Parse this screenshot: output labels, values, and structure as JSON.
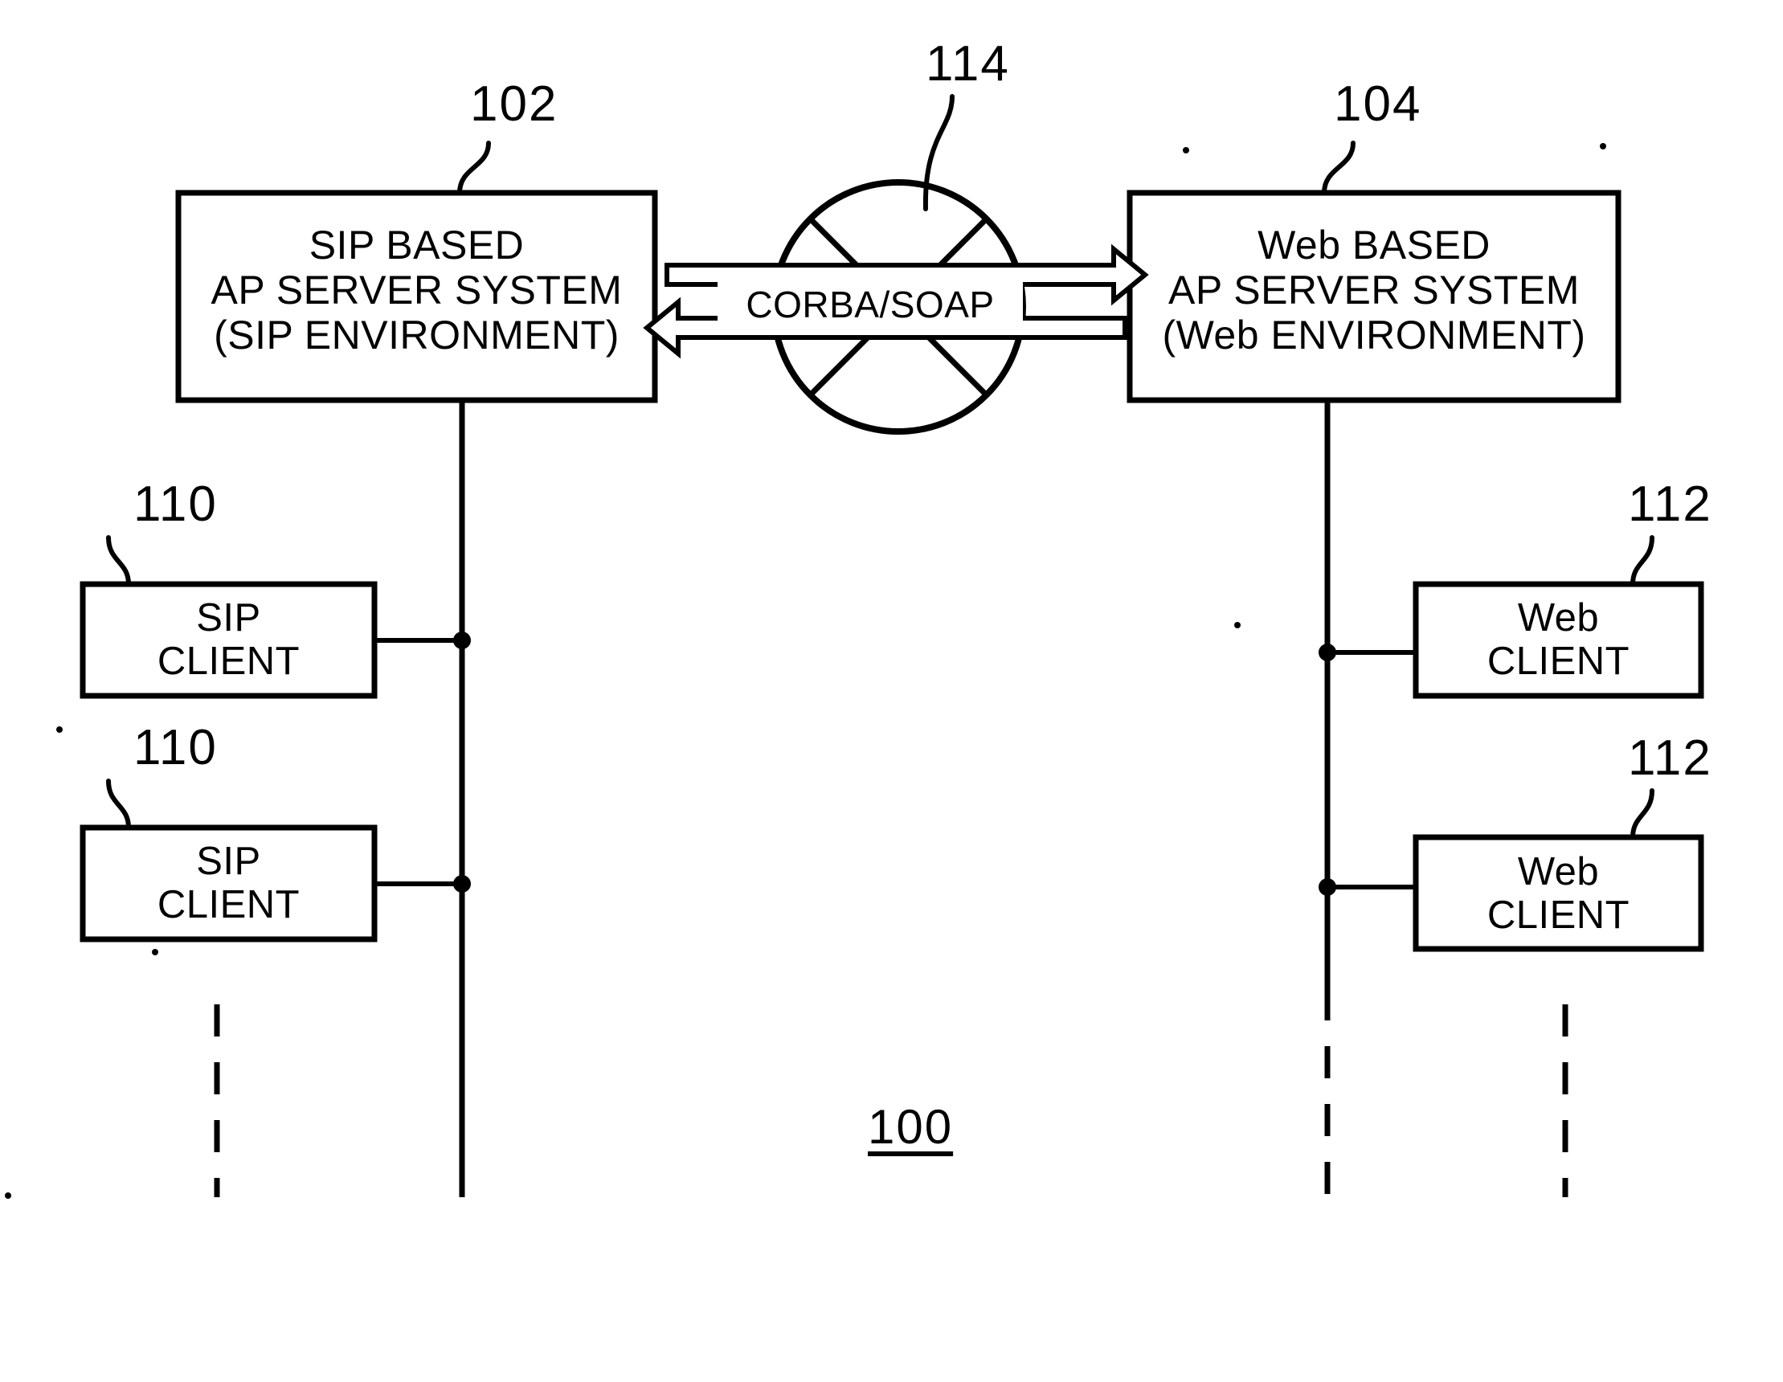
{
  "figure": {
    "number": "100",
    "type": "patent-block-diagram"
  },
  "nodes": {
    "sip_server": {
      "ref": "102",
      "line1": "SIP BASED",
      "line2": "AP SERVER SYSTEM",
      "line3": "(SIP ENVIRONMENT)"
    },
    "web_server": {
      "ref": "104",
      "line1": "Web BASED",
      "line2": "AP SERVER SYSTEM",
      "line3": "(Web ENVIRONMENT)"
    },
    "network": {
      "ref": "114",
      "protocol_label": "CORBA/SOAP"
    },
    "sip_client_1": {
      "ref": "110",
      "line1": "SIP",
      "line2": "CLIENT"
    },
    "sip_client_2": {
      "ref": "110",
      "line1": "SIP",
      "line2": "CLIENT"
    },
    "web_client_1": {
      "ref": "112",
      "line1": "Web",
      "line2": "CLIENT"
    },
    "web_client_2": {
      "ref": "112",
      "line1": "Web",
      "line2": "CLIENT"
    }
  },
  "style": {
    "stroke": "#000000",
    "background": "#ffffff"
  }
}
